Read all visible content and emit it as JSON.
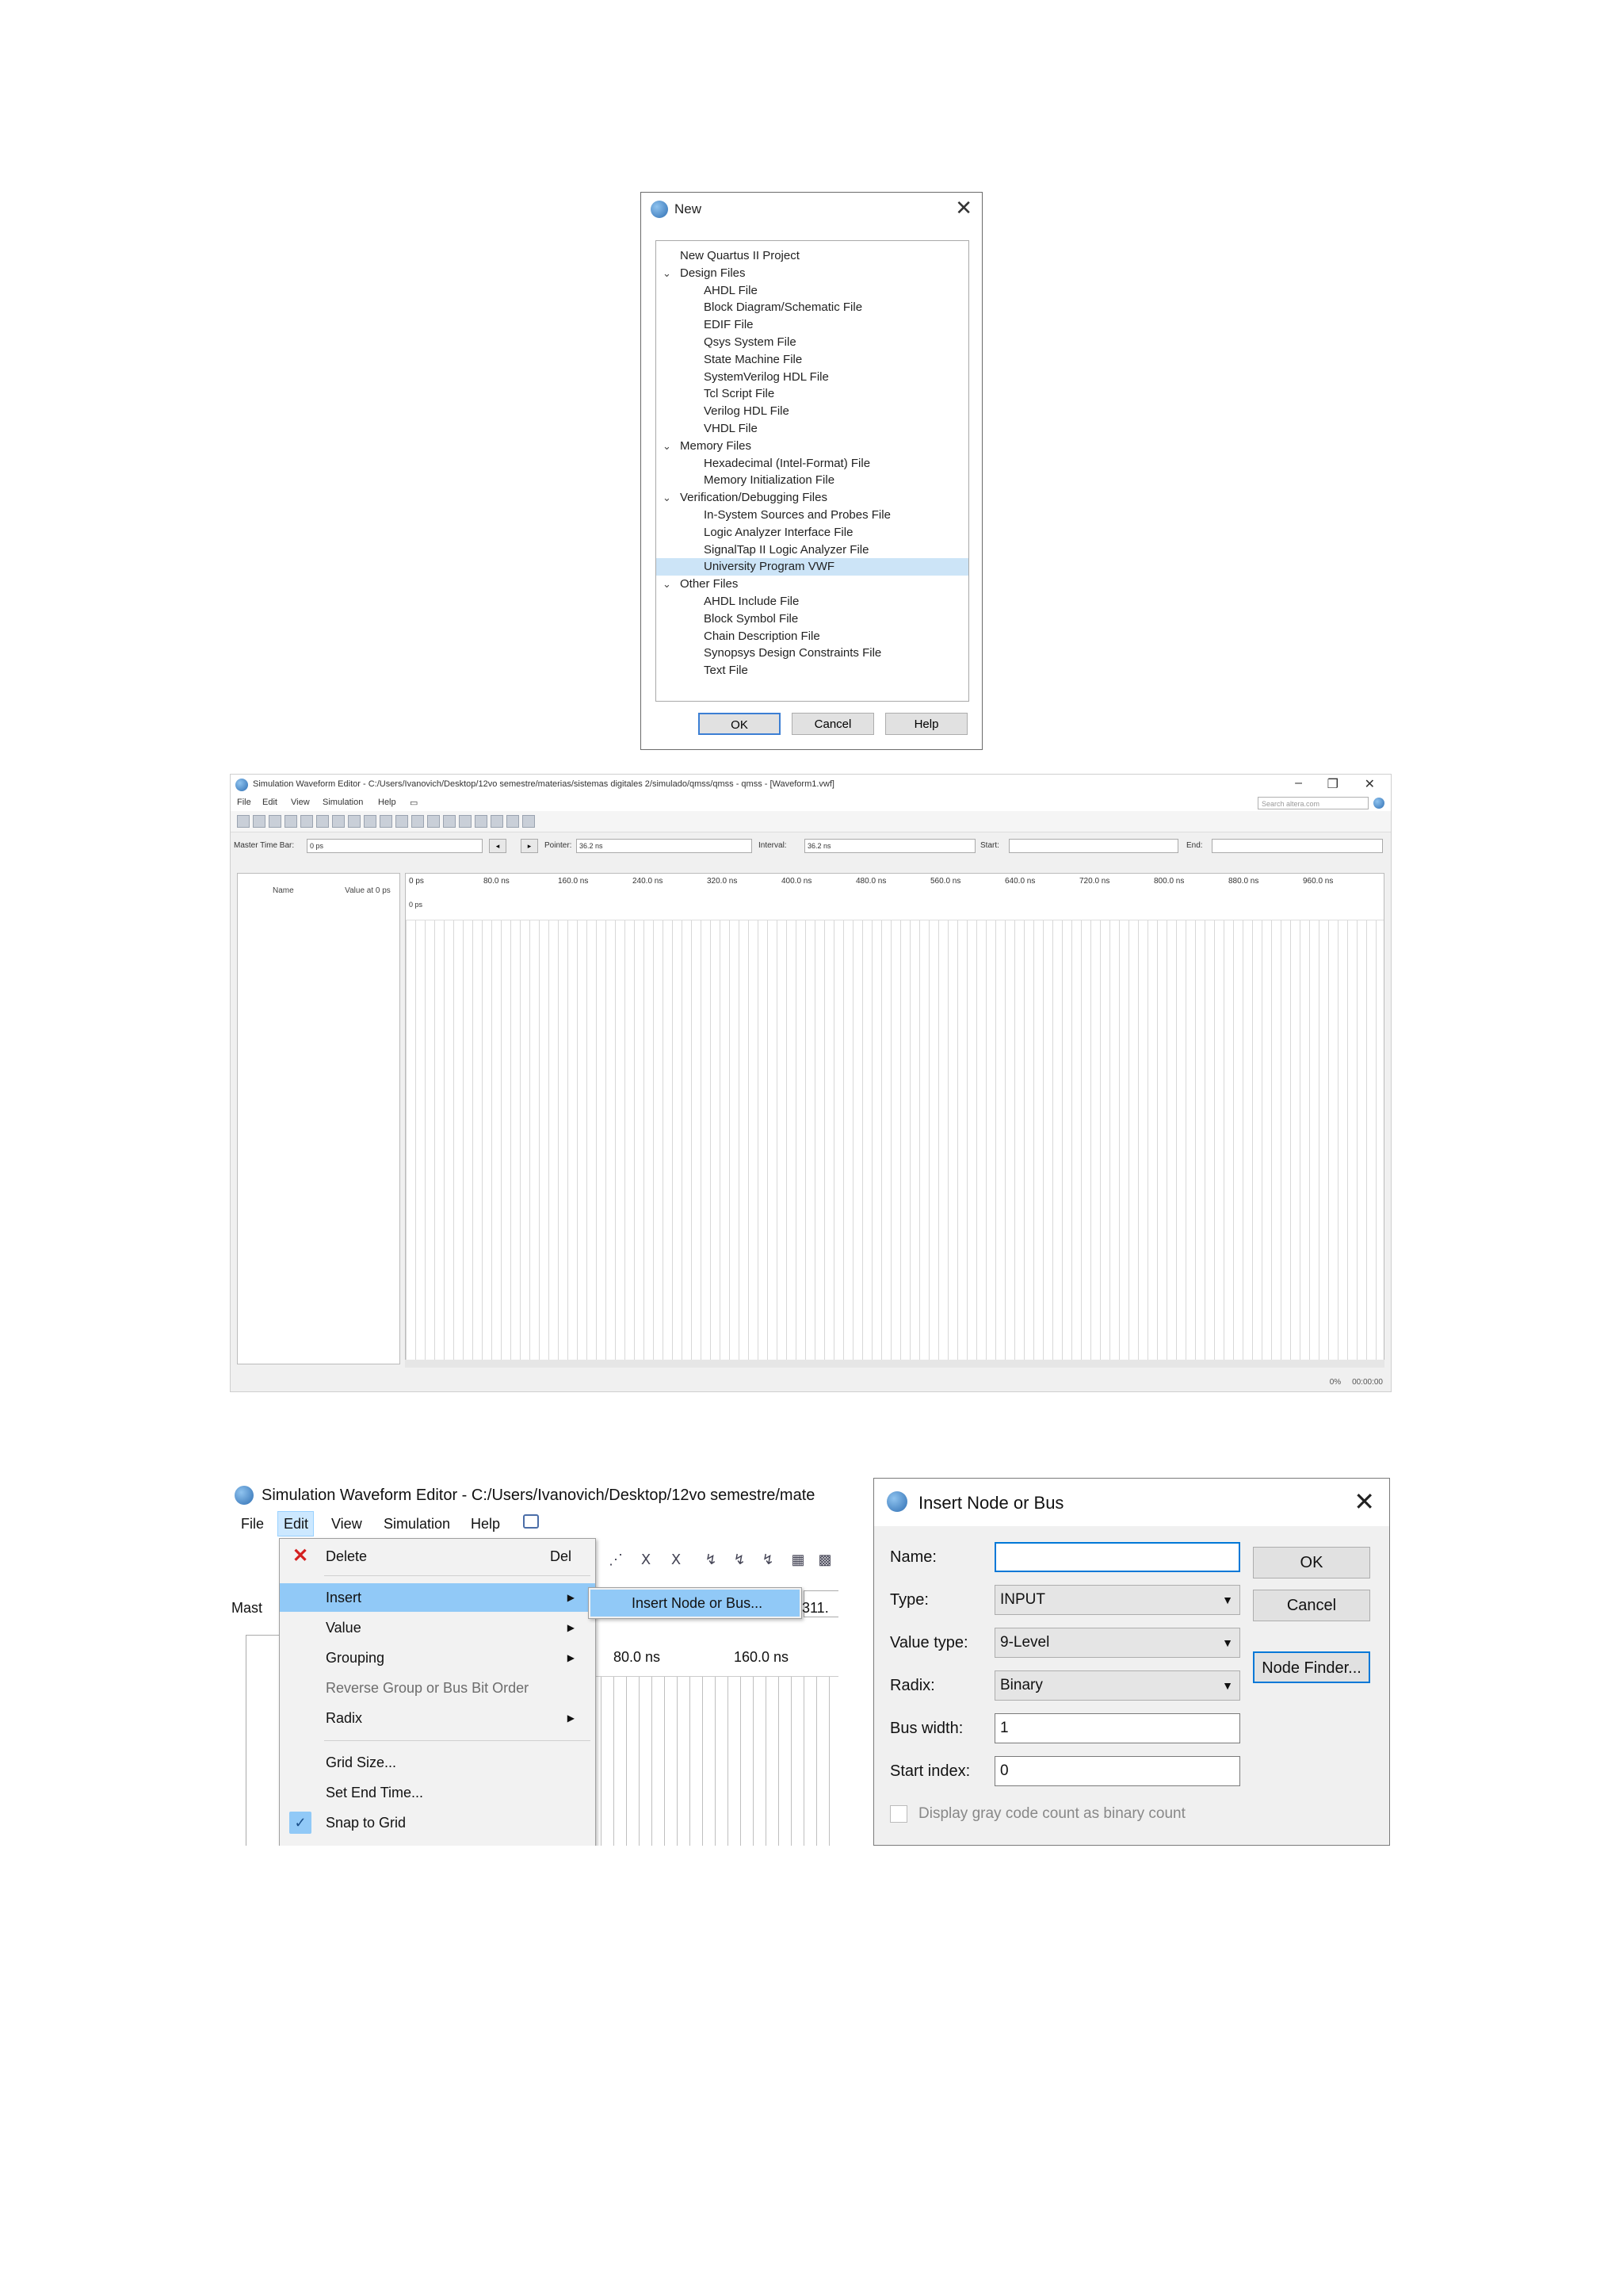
{
  "new_dialog": {
    "title": "New",
    "tree": [
      {
        "label": "New Quartus II Project",
        "level": 0,
        "expanded": null,
        "selected": false
      },
      {
        "label": "Design Files",
        "level": 0,
        "expanded": true,
        "selected": false
      },
      {
        "label": "AHDL File",
        "level": 1,
        "selected": false
      },
      {
        "label": "Block Diagram/Schematic File",
        "level": 1,
        "selected": false
      },
      {
        "label": "EDIF File",
        "level": 1,
        "selected": false
      },
      {
        "label": "Qsys System File",
        "level": 1,
        "selected": false
      },
      {
        "label": "State Machine File",
        "level": 1,
        "selected": false
      },
      {
        "label": "SystemVerilog HDL File",
        "level": 1,
        "selected": false
      },
      {
        "label": "Tcl Script File",
        "level": 1,
        "selected": false
      },
      {
        "label": "Verilog HDL File",
        "level": 1,
        "selected": false
      },
      {
        "label": "VHDL File",
        "level": 1,
        "selected": false
      },
      {
        "label": "Memory Files",
        "level": 0,
        "expanded": true,
        "selected": false
      },
      {
        "label": "Hexadecimal (Intel-Format) File",
        "level": 1,
        "selected": false
      },
      {
        "label": "Memory Initialization File",
        "level": 1,
        "selected": false
      },
      {
        "label": "Verification/Debugging Files",
        "level": 0,
        "expanded": true,
        "selected": false
      },
      {
        "label": "In-System Sources and Probes File",
        "level": 1,
        "selected": false
      },
      {
        "label": "Logic Analyzer Interface File",
        "level": 1,
        "selected": false
      },
      {
        "label": "SignalTap II Logic Analyzer File",
        "level": 1,
        "selected": false
      },
      {
        "label": "University Program VWF",
        "level": 1,
        "selected": true
      },
      {
        "label": "Other Files",
        "level": 0,
        "expanded": true,
        "selected": false
      },
      {
        "label": "AHDL Include File",
        "level": 1,
        "selected": false
      },
      {
        "label": "Block Symbol File",
        "level": 1,
        "selected": false
      },
      {
        "label": "Chain Description File",
        "level": 1,
        "selected": false
      },
      {
        "label": "Synopsys Design Constraints File",
        "level": 1,
        "selected": false
      },
      {
        "label": "Text File",
        "level": 1,
        "selected": false
      }
    ],
    "buttons": {
      "ok": "OK",
      "cancel": "Cancel",
      "help": "Help"
    }
  },
  "waveform_editor": {
    "title": "Simulation Waveform Editor - C:/Users/Ivanovich/Desktop/12vo semestre/materias/sistemas digitales 2/simulado/qmss/qmss - qmss - [Waveform1.vwf]",
    "menu": [
      "File",
      "Edit",
      "View",
      "Simulation",
      "Help"
    ],
    "search_placeholder": "Search altera.com",
    "master_time_bar_label": "Master Time Bar:",
    "master_time_bar_value": "0 ps",
    "pointer_label": "Pointer:",
    "pointer_value": "36.2 ns",
    "interval_label": "Interval:",
    "interval_value": "36.2 ns",
    "start_label": "Start:",
    "start_value": "",
    "end_label": "End:",
    "end_value": "",
    "name_header": "Name",
    "value_header": "Value at 0 ps",
    "time_ticks": [
      "0 ps",
      "80.0 ns",
      "160.0 ns",
      "240.0 ns",
      "320.0 ns",
      "400.0 ns",
      "480.0 ns",
      "560.0 ns",
      "640.0 ns",
      "720.0 ns",
      "800.0 ns",
      "880.0 ns",
      "960.0 ns"
    ],
    "cursor_label": "0 ps",
    "status_percent": "0%",
    "status_time": "00:00:00"
  },
  "edit_window": {
    "title": "Simulation Waveform Editor - C:/Users/Ivanovich/Desktop/12vo semestre/mate",
    "menu": [
      "File",
      "Edit",
      "View",
      "Simulation",
      "Help"
    ],
    "master_label_fragment": "Mast",
    "field_fragment": "311.",
    "ruler_ticks": [
      "80.0 ns",
      "160.0 ns"
    ],
    "edit_menu": {
      "delete": "Delete",
      "delete_shortcut": "Del",
      "insert": "Insert",
      "value": "Value",
      "grouping": "Grouping",
      "reverse_group": "Reverse Group or Bus Bit Order",
      "radix": "Radix",
      "grid_size": "Grid Size...",
      "set_end_time": "Set End Time...",
      "snap_to_grid": "Snap to Grid"
    },
    "submenu_item": "Insert Node or Bus..."
  },
  "insert_dialog": {
    "title": "Insert Node or Bus",
    "name_label": "Name:",
    "name_value": "",
    "type_label": "Type:",
    "type_value": "INPUT",
    "value_type_label": "Value type:",
    "value_type_value": "9-Level",
    "radix_label": "Radix:",
    "radix_value": "Binary",
    "bus_width_label": "Bus width:",
    "bus_width_value": "1",
    "start_index_label": "Start index:",
    "start_index_value": "0",
    "checkbox_label": "Display gray code count as binary count",
    "ok": "OK",
    "cancel": "Cancel",
    "node_finder": "Node Finder..."
  }
}
